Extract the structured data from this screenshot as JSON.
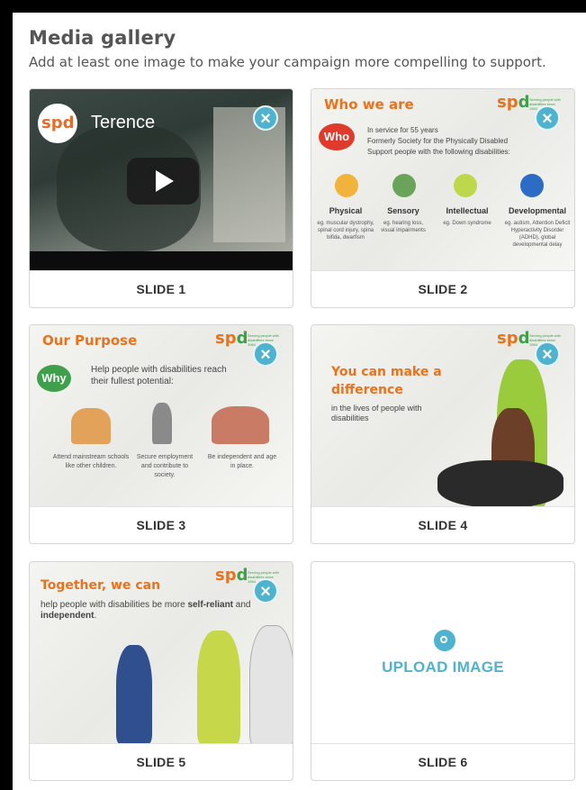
{
  "gallery": {
    "title": "Media gallery",
    "subtitle": "Add at least one image to make your campaign more compelling to support."
  },
  "slides": [
    {
      "label": "SLIDE 1",
      "video_title": "Terence",
      "logo": "spd"
    },
    {
      "label": "SLIDE 2",
      "heading": "Who we are",
      "bubble": "Who",
      "bullets": [
        "In service for 55 years",
        "Formerly Society for the Physically Disabled",
        "Support people with the following disabilities:"
      ],
      "categories": [
        {
          "name": "Physical",
          "desc": "eg. muscular dystrophy, spinal cord injury, spina bifida, dwarfism"
        },
        {
          "name": "Sensory",
          "desc": "eg. hearing loss, visual impairments"
        },
        {
          "name": "Intellectual",
          "desc": "eg. Down syndrome"
        },
        {
          "name": "Developmental",
          "desc": "eg. autism, Attention Deficit Hyperactivity Disorder (ADHD), global developmental delay"
        }
      ]
    },
    {
      "label": "SLIDE 3",
      "heading": "Our Purpose",
      "bubble": "Why",
      "line1": "Help people with disabilities reach",
      "line2": "their fullest potential:",
      "items": [
        "Attend mainstream schools like other children.",
        "Secure employment and contribute to society.",
        "Be independent and age in place."
      ]
    },
    {
      "label": "SLIDE 4",
      "heading_line1": "You can make a",
      "heading_line2": "difference",
      "sub_line1": "in the lives of people with",
      "sub_line2": "disabilities"
    },
    {
      "label": "SLIDE 5",
      "heading": "Together, we can",
      "line_pre": "help people with disabilities be more ",
      "bold1": "self-reliant",
      "line_mid": " and",
      "bold2": "independent",
      "line_post": "."
    },
    {
      "label": "SLIDE 6",
      "upload": "UPLOAD IMAGE"
    }
  ],
  "logo": {
    "s": "s",
    "p": "p",
    "d": "d",
    "tagline": "Serving people with disabilities since 1964"
  },
  "close_glyph": "×",
  "colors": {
    "accent": "#4fb3cf",
    "brand_orange": "#e8731f",
    "brand_green": "#3ea04a"
  }
}
